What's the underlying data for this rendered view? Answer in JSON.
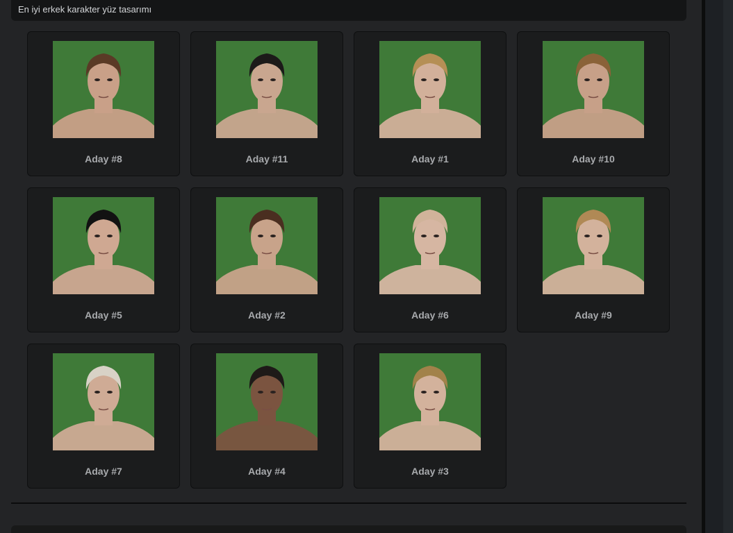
{
  "header": {
    "title": "En iyi erkek karakter yüz tasarımı"
  },
  "colors": {
    "background": "#232426",
    "card": "#1b1c1d",
    "portrait_bg": "#3f7a38",
    "label": "#a8aaad"
  },
  "candidates": [
    {
      "label": "Aday #8",
      "hair": "#5a3a26",
      "skin": "#c9a088"
    },
    {
      "label": "Aday #11",
      "hair": "#1c1a19",
      "skin": "#c9a68f"
    },
    {
      "label": "Aday #1",
      "hair": "#b58f55",
      "skin": "#d2b09a"
    },
    {
      "label": "Aday #10",
      "hair": "#8a6238",
      "skin": "#c7a088"
    },
    {
      "label": "Aday #5",
      "hair": "#121212",
      "skin": "#cfa892"
    },
    {
      "label": "Aday #2",
      "hair": "#4a2e20",
      "skin": "#c8a38a"
    },
    {
      "label": "Aday #6",
      "hair": "#d0b39a",
      "skin": "#d6b6a2"
    },
    {
      "label": "Aday #9",
      "hair": "#b08955",
      "skin": "#d3b29c"
    },
    {
      "label": "Aday #7",
      "hair": "#d8d2c6",
      "skin": "#cfab95"
    },
    {
      "label": "Aday #4",
      "hair": "#1e1a18",
      "skin": "#7b5440"
    },
    {
      "label": "Aday #3",
      "hair": "#a2824a",
      "skin": "#d3b29c"
    }
  ]
}
